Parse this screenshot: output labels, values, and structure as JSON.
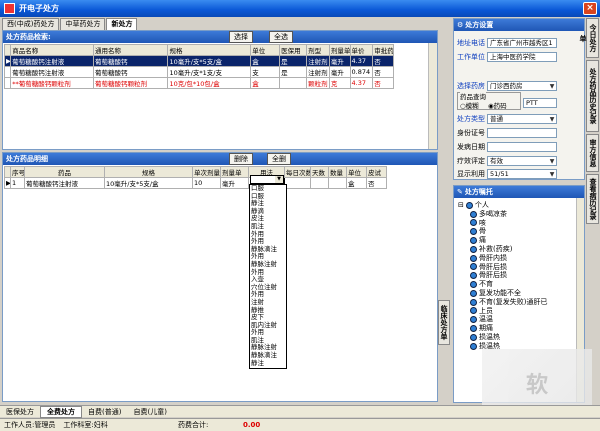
{
  "window": {
    "title": "开电子处方",
    "close": "×"
  },
  "tabs": [
    {
      "label": "西(中成)药处方"
    },
    {
      "label": "中草药处方"
    },
    {
      "label": "新处方"
    }
  ],
  "search_panel": {
    "title": "处方药品检索:",
    "btn_select": "选择",
    "btn_all": "全选",
    "columns": [
      "商品名称",
      "通用名称",
      "规格",
      "单位",
      "医保用",
      "剂型",
      "剂量单",
      "单价",
      "审批药"
    ],
    "rows": [
      {
        "cells": [
          "葡萄糖酸钙注射液",
          "葡萄糖酸钙",
          "10毫升/支*5支/盒",
          "盒",
          "是",
          "注射剂",
          "毫升",
          "4.37",
          "否"
        ],
        "state": "selected"
      },
      {
        "cells": [
          "葡萄糖酸钙注射液",
          "葡萄糖酸钙",
          "10毫升/支*1支/支",
          "支",
          "是",
          "注射剂",
          "毫升",
          "0.874",
          "否"
        ],
        "state": ""
      },
      {
        "cells": [
          "**葡萄糖酸钙颗粒剂",
          "葡萄糖酸钙颗粒剂",
          "10克/包*10包/盒",
          "盒",
          "",
          "颗粒剂",
          "克",
          "4.37",
          "否"
        ],
        "state": "red"
      }
    ]
  },
  "detail_panel": {
    "title": "处方药品明细",
    "btn_delete": "删除",
    "btn_clear": "全删",
    "columns": [
      "序号",
      "药品",
      "规格",
      "单次剂量",
      "剂量单",
      "用法",
      "每日次数",
      "天数",
      "数量",
      "单位",
      "皮试"
    ],
    "rows": [
      {
        "cells": [
          "1",
          "葡萄糖酸钙注射液",
          "10毫升/支*5支/盒",
          "10",
          "毫升",
          "",
          "",
          "",
          "",
          "盒",
          "否"
        ]
      }
    ]
  },
  "usage_dropdown": [
    "口服",
    "口服",
    "静注",
    "静滴",
    "皮注",
    "肌注",
    "外用",
    "外用",
    "静脉滴注",
    "外用",
    "静脉注射",
    "外用",
    "入壶",
    "穴位注射",
    "外用",
    "注射",
    "静推",
    "皮下",
    "肌内注射",
    "外用",
    "肌注",
    "静脉注射",
    "静脉滴注",
    "静注"
  ],
  "right_tabs": [
    "今日处方单",
    "处方药品历史记录",
    "审方信息",
    "查看病历记录"
  ],
  "settings": {
    "title": "处方设置",
    "address_label": "地址电话",
    "address_value": "广东省广州市越秀区1",
    "workplace_label": "工作单位",
    "workplace_value": "上海中医药学院",
    "pharmacy_label": "选择药房",
    "pharmacy_value": "门诊西药房",
    "search_label": "药品查询",
    "opt_fuzzy": "模糊",
    "opt_pinyin": "药码",
    "search_value": "PTT",
    "type_label": "处方类型",
    "type_value": "普通",
    "id_label": "身份证号",
    "id_value": "",
    "date_label": "发病日期",
    "date_value": "",
    "eval_label": "疗效评定",
    "eval_value": "有效",
    "display_label": "显示利用",
    "display_value": "51/51"
  },
  "memo": {
    "title": "处方嘱托",
    "items": [
      "个人",
      "多喝凉茶",
      "咳",
      "骨",
      "痛",
      "补救(药疾)",
      "骨肝内损",
      "骨肝后损",
      "骨肝后损",
      "不育",
      "复发功能不全",
      "不育(复发失败)通肝已",
      "上员",
      "温温",
      "期痛",
      "损温热",
      "损温热"
    ]
  },
  "side_vertical": "临床处方单",
  "status": {
    "items": [
      "医保处方",
      "全费处方",
      "自费(普通)",
      "自费(儿童)"
    ],
    "staff_label": "工作人员:",
    "staff_value": "管理员",
    "unit_label": "工作科室:",
    "unit_value": "妇科",
    "total_label": "药费合计:",
    "total_value": "0.00"
  },
  "watermark": "软"
}
